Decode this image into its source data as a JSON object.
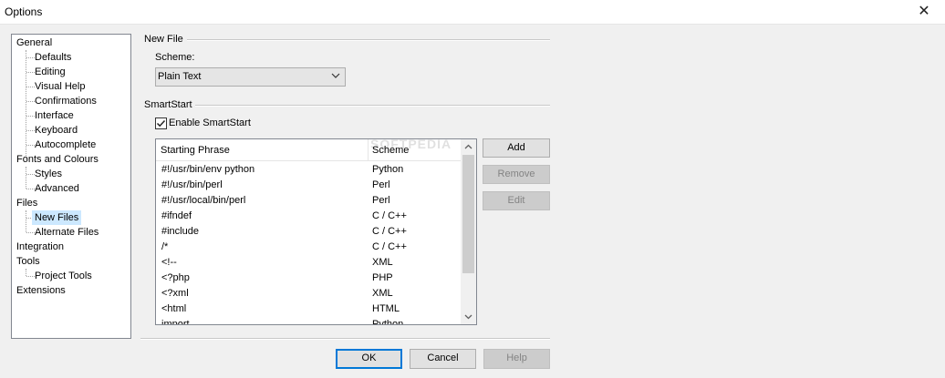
{
  "window": {
    "title": "Options",
    "close_glyph": "✕"
  },
  "tree": {
    "nodes": [
      {
        "label": "General"
      },
      {
        "label": "Defaults"
      },
      {
        "label": "Editing"
      },
      {
        "label": "Visual Help"
      },
      {
        "label": "Confirmations"
      },
      {
        "label": "Interface"
      },
      {
        "label": "Keyboard"
      },
      {
        "label": "Autocomplete"
      },
      {
        "label": "Fonts and Colours"
      },
      {
        "label": "Styles"
      },
      {
        "label": "Advanced"
      },
      {
        "label": "Files"
      },
      {
        "label": "New Files",
        "selected": true
      },
      {
        "label": "Alternate Files"
      },
      {
        "label": "Integration"
      },
      {
        "label": "Tools"
      },
      {
        "label": "Project Tools"
      },
      {
        "label": "Extensions"
      }
    ]
  },
  "new_file": {
    "group_title": "New File",
    "scheme_label": "Scheme:",
    "scheme_value": "Plain Text"
  },
  "smartstart": {
    "group_title": "SmartStart",
    "enable_label": "Enable SmartStart",
    "enabled": true,
    "columns": [
      "Starting Phrase",
      "Scheme"
    ],
    "rows": [
      [
        "#!/usr/bin/env python",
        "Python"
      ],
      [
        "#!/usr/bin/perl",
        "Perl"
      ],
      [
        "#!/usr/local/bin/perl",
        "Perl"
      ],
      [
        "#ifndef",
        "C / C++"
      ],
      [
        "#include",
        "C / C++"
      ],
      [
        "/*",
        "C / C++"
      ],
      [
        "<!--",
        "XML"
      ],
      [
        "<?php",
        "PHP"
      ],
      [
        "<?xml",
        "XML"
      ],
      [
        "<html",
        "HTML"
      ],
      [
        "import",
        "Python"
      ]
    ],
    "buttons": {
      "add": "Add",
      "remove": "Remove",
      "edit": "Edit"
    }
  },
  "footer": {
    "ok": "OK",
    "cancel": "Cancel",
    "help": "Help"
  },
  "watermark": "SOFTPEDIA",
  "colors": {
    "selection": "#cce8ff",
    "default_button_border": "#0078d7"
  }
}
